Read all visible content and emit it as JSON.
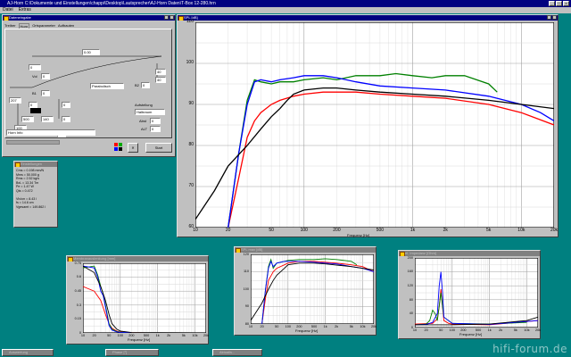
{
  "app": {
    "title": "AJ-Horn C:\\Dokumente und Einstellungen\\chappi\\Desktop\\Lautsprecher\\AJ-Horn Daten\\T-Box 12-280.hrn",
    "menu": [
      "Datei",
      "Extras"
    ]
  },
  "colors": {
    "desktop": "#008080",
    "active_title": "#000080",
    "inactive_title": "#808080",
    "red": "#ff0000",
    "green": "#008000",
    "blue": "#0000ff",
    "black": "#000000"
  },
  "horn_window": {
    "title": "Dateneingabe",
    "tabs": [
      "Treiber",
      "Horn",
      "Ortsparameter",
      "Aufbauten"
    ],
    "active_tab": "Horn",
    "values": {
      "top_field": "0.00",
      "top_unit": "m",
      "s_field": "0",
      "v_field": "0",
      "vol_label": "Vol",
      "profile": "Parabolisch",
      "l1_a": "40",
      "l1_b": "40",
      "l1_unit_a": "cm",
      "l1_unit_b": "cm",
      "b1_label": "B1",
      "b2_label": "B2",
      "s1_a": "0",
      "s1_b": "0",
      "s1_c": "0",
      "s1_d": "0",
      "x1": "207",
      "x2": "500",
      "x3": "140",
      "x4": "100",
      "x5": "0",
      "x6": "33",
      "unit_1": "cm²",
      "unit_2": "cm²",
      "unit_3": "L",
      "unit_4": "cm²",
      "unit_5": "Hz",
      "name_field": "Horn Info"
    },
    "aufstellung": {
      "label": "Aufstellung",
      "value": "Halbraum",
      "rows": [
        {
          "label": "Abst",
          "value": "0",
          "unit": "m"
        },
        {
          "label": "ALT",
          "value": "0",
          "unit": "m"
        },
        {
          "label": "ALT2",
          "value": "0",
          "unit": "m"
        }
      ]
    },
    "start_button": "Start",
    "close_button": "✕"
  },
  "driver_window": {
    "title": "Einstellungen",
    "lines": [
      "Cms = 0.198 mm/N",
      "Mms = 50.000 g",
      "Rms = 2.52 kg/s",
      "BxL = 13.34 Tm",
      "Pe = 1.47 W",
      "Qts = 0.472",
      "",
      "Vh/cm = 8.43 l",
      "fs = 14.6 cm",
      "Vgesamt = 149.862 l"
    ]
  },
  "spl_main": {
    "title": "SPL [dB]",
    "x_label": "Frequenz [Hz]",
    "x_ticks": [
      "10",
      "20",
      "50",
      "100",
      "200",
      "500",
      "1k",
      "2k",
      "5k",
      "10k",
      "20k"
    ],
    "y_ticks": [
      "110",
      "100",
      "90",
      "80",
      "70",
      "60"
    ]
  },
  "membran_window": {
    "title": "Membranauslenkung [mm]",
    "x_label": "Frequenz [Hz]",
    "x_ticks": [
      "10",
      "20",
      "50",
      "100",
      "200",
      "500",
      "1k",
      "2k",
      "5k",
      "10k",
      "20k"
    ],
    "y_ticks": [
      "0.75",
      "0.6",
      "0.45",
      "0.3",
      "0.15",
      "0"
    ]
  },
  "spl_small_window": {
    "title": "SPL max [dB]",
    "x_label": "Frequenz [Hz]",
    "x_ticks": [
      "10",
      "20",
      "50",
      "100",
      "200",
      "500",
      "1k",
      "2k",
      "5k",
      "10k",
      "20k"
    ],
    "y_ticks": [
      "120",
      "110",
      "100",
      "90",
      "80"
    ]
  },
  "impedance_window": {
    "title": "el. Impedanz [Ohm]",
    "x_label": "Frequenz [Hz]",
    "x_ticks": [
      "10",
      "20",
      "50",
      "100",
      "200",
      "500",
      "1k",
      "2k",
      "5k",
      "10k",
      "20k"
    ],
    "y_ticks": [
      "200",
      "160",
      "120",
      "80",
      "40",
      "0"
    ]
  },
  "taskbar_items": [
    "Auswertung",
    "Phase [°]",
    "Aktualis..."
  ],
  "watermark": "hifi-forum.de",
  "chart_data": [
    {
      "type": "line",
      "title": "SPL [dB]",
      "xlabel": "Frequenz [Hz]",
      "xscale": "log",
      "xlim": [
        10,
        20000
      ],
      "ylim": [
        60,
        110
      ],
      "series": [
        {
          "color": "#ff0000",
          "x": [
            20,
            25,
            30,
            35,
            40,
            50,
            60,
            80,
            100,
            150,
            200,
            300,
            500,
            1000,
            2000,
            5000,
            10000,
            20000
          ],
          "y": [
            60,
            72,
            82,
            86,
            88,
            90,
            91,
            92,
            92.5,
            93,
            93,
            93,
            92.5,
            92,
            91.5,
            90,
            88,
            85
          ]
        },
        {
          "color": "#008000",
          "x": [
            20,
            25,
            30,
            35,
            40,
            50,
            60,
            80,
            100,
            150,
            200,
            300,
            500,
            700,
            1000,
            1500,
            2000,
            3000,
            5000,
            6000
          ],
          "y": [
            60,
            78,
            91,
            96,
            95.5,
            95,
            95.5,
            95.5,
            96,
            96.5,
            96,
            97,
            97,
            97.5,
            97,
            96.5,
            97,
            97,
            95,
            93
          ]
        },
        {
          "color": "#0000ff",
          "x": [
            20,
            25,
            30,
            35,
            40,
            50,
            60,
            80,
            100,
            150,
            200,
            300,
            500,
            1000,
            2000,
            5000,
            10000,
            15000,
            20000
          ],
          "y": [
            60,
            78,
            90,
            95.5,
            96,
            95.5,
            96,
            96.5,
            97,
            97,
            96.5,
            95.5,
            94.5,
            94,
            93.5,
            92,
            90,
            88,
            86
          ]
        },
        {
          "color": "#000000",
          "x": [
            10,
            15,
            20,
            30,
            40,
            50,
            60,
            70,
            80,
            100,
            150,
            200,
            300,
            500,
            1000,
            2000,
            5000,
            10000,
            20000
          ],
          "y": [
            62,
            69,
            75,
            80,
            84,
            87,
            89,
            91,
            92.5,
            93.5,
            94,
            94,
            93.5,
            93,
            92.5,
            92,
            91,
            90,
            89
          ]
        }
      ]
    },
    {
      "type": "line",
      "title": "Membranauslenkung [mm]",
      "xlabel": "Frequenz [Hz]",
      "xscale": "log",
      "xlim": [
        10,
        20000
      ],
      "ylim": [
        0,
        0.75
      ],
      "series": [
        {
          "color": "#ff0000",
          "x": [
            10,
            20,
            30,
            40,
            50,
            60,
            80,
            100,
            200,
            500,
            1000,
            20000
          ],
          "y": [
            0.5,
            0.45,
            0.35,
            0.2,
            0.1,
            0.05,
            0.02,
            0.01,
            0.003,
            0.001,
            0,
            0
          ]
        },
        {
          "color": "#008000",
          "x": [
            10,
            20,
            25,
            30,
            35,
            40,
            50,
            60,
            80,
            100,
            200,
            20000
          ],
          "y": [
            0.7,
            0.72,
            0.62,
            0.5,
            0.42,
            0.3,
            0.1,
            0.04,
            0.015,
            0.008,
            0.002,
            0
          ]
        },
        {
          "color": "#0000ff",
          "x": [
            10,
            20,
            25,
            30,
            35,
            40,
            50,
            60,
            80,
            100,
            200,
            20000
          ],
          "y": [
            0.72,
            0.7,
            0.6,
            0.45,
            0.4,
            0.28,
            0.08,
            0.03,
            0.012,
            0.006,
            0.002,
            0
          ]
        },
        {
          "color": "#000000",
          "x": [
            10,
            20,
            30,
            40,
            50,
            60,
            80,
            100,
            200,
            20000
          ],
          "y": [
            0.72,
            0.65,
            0.5,
            0.35,
            0.2,
            0.1,
            0.04,
            0.02,
            0.004,
            0
          ]
        }
      ]
    },
    {
      "type": "line",
      "title": "SPL max [dB]",
      "xlabel": "Frequenz [Hz]",
      "xscale": "log",
      "xlim": [
        10,
        20000
      ],
      "ylim": [
        80,
        120
      ],
      "series": [
        {
          "color": "#ff0000",
          "x": [
            20,
            25,
            30,
            40,
            50,
            80,
            100,
            200,
            500,
            1000,
            2000,
            5000,
            10000,
            20000
          ],
          "y": [
            80,
            95,
            105,
            110,
            112,
            114,
            115,
            116,
            116,
            115.5,
            115,
            114,
            113,
            110
          ]
        },
        {
          "color": "#008000",
          "x": [
            20,
            25,
            30,
            35,
            40,
            50,
            80,
            100,
            200,
            500,
            1000,
            2000,
            5000,
            7000
          ],
          "y": [
            80,
            100,
            113,
            117,
            112,
            115,
            116,
            116.5,
            117,
            117,
            117.5,
            117,
            116,
            114
          ]
        },
        {
          "color": "#0000ff",
          "x": [
            20,
            25,
            30,
            35,
            40,
            50,
            80,
            100,
            200,
            500,
            1000,
            2000,
            5000,
            10000,
            20000
          ],
          "y": [
            80,
            100,
            112,
            116,
            113,
            115,
            116,
            116,
            116,
            115.5,
            115,
            114.5,
            113,
            112,
            110
          ]
        },
        {
          "color": "#000000",
          "x": [
            10,
            20,
            30,
            40,
            50,
            80,
            100,
            200,
            500,
            1000,
            5000,
            20000
          ],
          "y": [
            82,
            92,
            100,
            105,
            108,
            112,
            114,
            115,
            115,
            114.5,
            113,
            111
          ]
        }
      ]
    },
    {
      "type": "line",
      "title": "el. Impedanz [Ohm]",
      "xlabel": "Frequenz [Hz]",
      "xscale": "log",
      "xlim": [
        10,
        20000
      ],
      "ylim": [
        0,
        200
      ],
      "series": [
        {
          "color": "#ff0000",
          "x": [
            10,
            30,
            40,
            45,
            50,
            55,
            60,
            80,
            100,
            1000,
            20000
          ],
          "y": [
            10,
            12,
            25,
            60,
            110,
            60,
            20,
            12,
            10,
            8,
            20
          ]
        },
        {
          "color": "#008000",
          "x": [
            10,
            20,
            25,
            30,
            35,
            40,
            50,
            60,
            100,
            1000,
            10000
          ],
          "y": [
            8,
            10,
            20,
            50,
            40,
            20,
            100,
            30,
            12,
            10,
            15
          ]
        },
        {
          "color": "#0000ff",
          "x": [
            10,
            20,
            30,
            40,
            45,
            50,
            55,
            60,
            100,
            1000,
            20000
          ],
          "y": [
            8,
            9,
            15,
            40,
            120,
            160,
            100,
            30,
            12,
            9,
            20
          ]
        },
        {
          "color": "#000000",
          "x": [
            10,
            100,
            1000,
            10000,
            20000
          ],
          "y": [
            8,
            8,
            10,
            20,
            30
          ]
        }
      ]
    }
  ]
}
